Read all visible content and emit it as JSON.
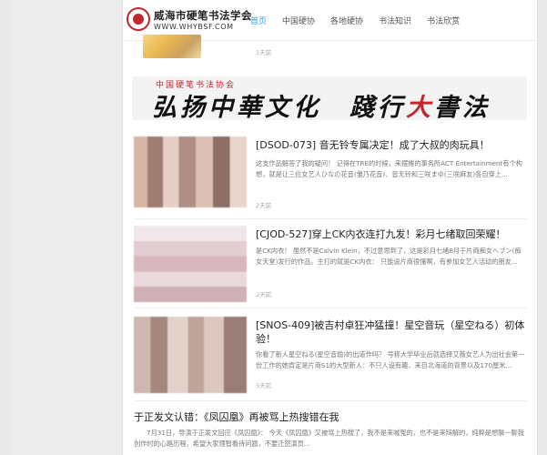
{
  "header": {
    "logo_cn": "威海市硬笔书法学会",
    "logo_en": "WWW.WHYBSF.COM",
    "nav": [
      "首页",
      "中国硬协",
      "各地硬协",
      "书法知识",
      "书法欣赏"
    ],
    "active_nav": "首页"
  },
  "top_item": {
    "time": "1天前"
  },
  "banner": {
    "sub": "中国硬笔书法协会",
    "main_black": "弘扬中華文化　踐行",
    "main_red": "大",
    "main_tail": "書法"
  },
  "articles": [
    {
      "title": "[DSOD-073] 音无铃专属决定！成了大叔的肉玩具！",
      "desc": "这支作品解答了我的疑问！ 记得在TRE的时候，来摆摊的事务所ACT Entertainment有个构想，就是让三位女艺人ひなの花音(雏乃花音)、音无铃和三咲まゆ(三咲麻友)各自穿上...",
      "time": "2天前"
    },
    {
      "title": "[CJOD-527]穿上CK内衣连打九发！彩月七绪取回荣耀！",
      "desc": "是CK内衣！ 虽然不是Calvin Klein，不过意思到了，这是彩月七绪8月于片商痴女へブン(痴女天堂)发行的作品，主打的就是CK内衣： 只能说片商很懂啊，有参加女艺人活动的朋友...",
      "time": "2天前"
    },
    {
      "title": "[SNOS-409]被吉村卓狂冲猛撞！星空音玩（星空ねる）初体验！",
      "desc": "你看了新人星空ねる(星空音瑜)的出道作吗？ 号称大学毕业后就选择艾薇女艺人为出社会第一份工作的她肯定是片商S1的大型新人：不只人设有趣、来自北海道的背景以及170厘米...",
      "time": "3天前"
    }
  ],
  "plain_article": {
    "title": "于正发文认错：《凤囚凰》再被骂上热搜错在我",
    "desc": "7月31日，导演于正发文回应《凤囚凰》： 今天《凤囚凰》又被骂上热搜了，我不是来喊冤的，也不是来辩解的，纯粹是想聊一聊我创作时的心路历程，希望大家理智看待问题，不要迁怒演员..."
  },
  "colors": {
    "accent": "#2a9ee0",
    "brand_red": "#c1272d"
  }
}
